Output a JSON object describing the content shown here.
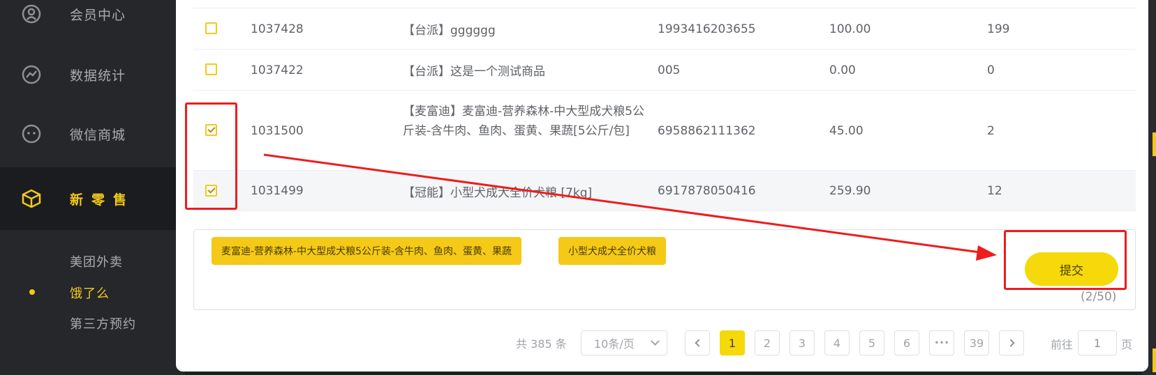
{
  "sidebar": {
    "items": [
      {
        "label": "会员中心",
        "icon": "member-icon"
      },
      {
        "label": "数据统计",
        "icon": "chart-icon"
      },
      {
        "label": "微信商城",
        "icon": "wechat-icon"
      },
      {
        "label": "新零售",
        "icon": "cube-icon"
      }
    ],
    "sub_items": [
      {
        "label": "美团外卖"
      },
      {
        "label": "饿了么"
      },
      {
        "label": "第三方预约"
      }
    ]
  },
  "table": {
    "rows": [
      {
        "id": "1037428",
        "name": "【台派】gggggg",
        "barcode": "1993416203655",
        "price": "100.00",
        "stock": "199",
        "checked": false
      },
      {
        "id": "1037422",
        "name": "【台派】这是一个测试商品",
        "barcode": "005",
        "price": "0.00",
        "stock": "0",
        "checked": false
      },
      {
        "id": "1031500",
        "name": "【麦富迪】麦富迪-营养森林-中大型成犬粮5公斤装-含牛肉、鱼肉、蛋黄、果蔬[5公斤/包]",
        "barcode": "6958862111362",
        "price": "45.00",
        "stock": "2",
        "checked": true
      },
      {
        "id": "1031499",
        "name": "【冠能】小型犬成犬全价犬粮 [7kg]",
        "barcode": "6917878050416",
        "price": "259.90",
        "stock": "12",
        "checked": true
      }
    ]
  },
  "selected": {
    "tags": [
      "麦富迪-营养森林-中大型成犬粮5公斤装-含牛肉、鱼肉、蛋黄、果蔬",
      "小型犬成犬全价犬粮"
    ],
    "submit_label": "提交",
    "counter": "(2/50)"
  },
  "pagination": {
    "total": "共 385 条",
    "page_size": "10条/页",
    "pages": [
      "1",
      "2",
      "3",
      "4",
      "5",
      "6",
      "•••",
      "39"
    ],
    "current": "1",
    "goto_label": "前往",
    "goto_value": "1",
    "goto_unit": "页"
  },
  "colors": {
    "accent": "#f5d90a",
    "sidebar_bg": "#26272b",
    "annotation": "#ee1c1c"
  }
}
